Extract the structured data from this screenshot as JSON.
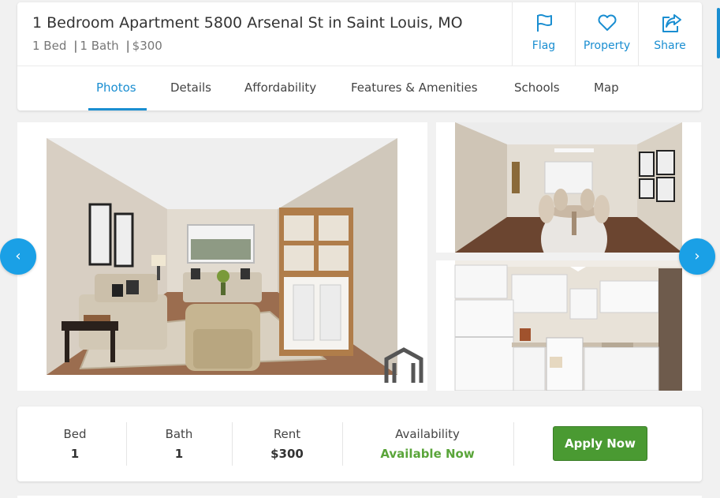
{
  "listing": {
    "title": "1 Bedroom Apartment 5800 Arsenal St in Saint Louis, MO",
    "beds": "1 Bed",
    "baths": "1 Bath",
    "price": "$300"
  },
  "actions": {
    "flag": "Flag",
    "property": "Property",
    "share": "Share"
  },
  "tabs": [
    "Photos",
    "Details",
    "Affordability",
    "Features & Amenities",
    "Schools",
    "Map"
  ],
  "active_tab": "Photos",
  "gallery": {
    "prev_icon": "chevron-left-icon",
    "next_icon": "chevron-right-icon"
  },
  "summary": {
    "bed_label": "Bed",
    "bed_value": "1",
    "bath_label": "Bath",
    "bath_value": "1",
    "rent_label": "Rent",
    "rent_value": "$300",
    "availability_label": "Availability",
    "availability_value": "Available Now",
    "apply_label": "Apply Now"
  },
  "colors": {
    "accent": "#1a8ed1",
    "nav_button": "#1aa0e6",
    "apply_button": "#4a9a32",
    "available_text": "#5aa53a"
  }
}
